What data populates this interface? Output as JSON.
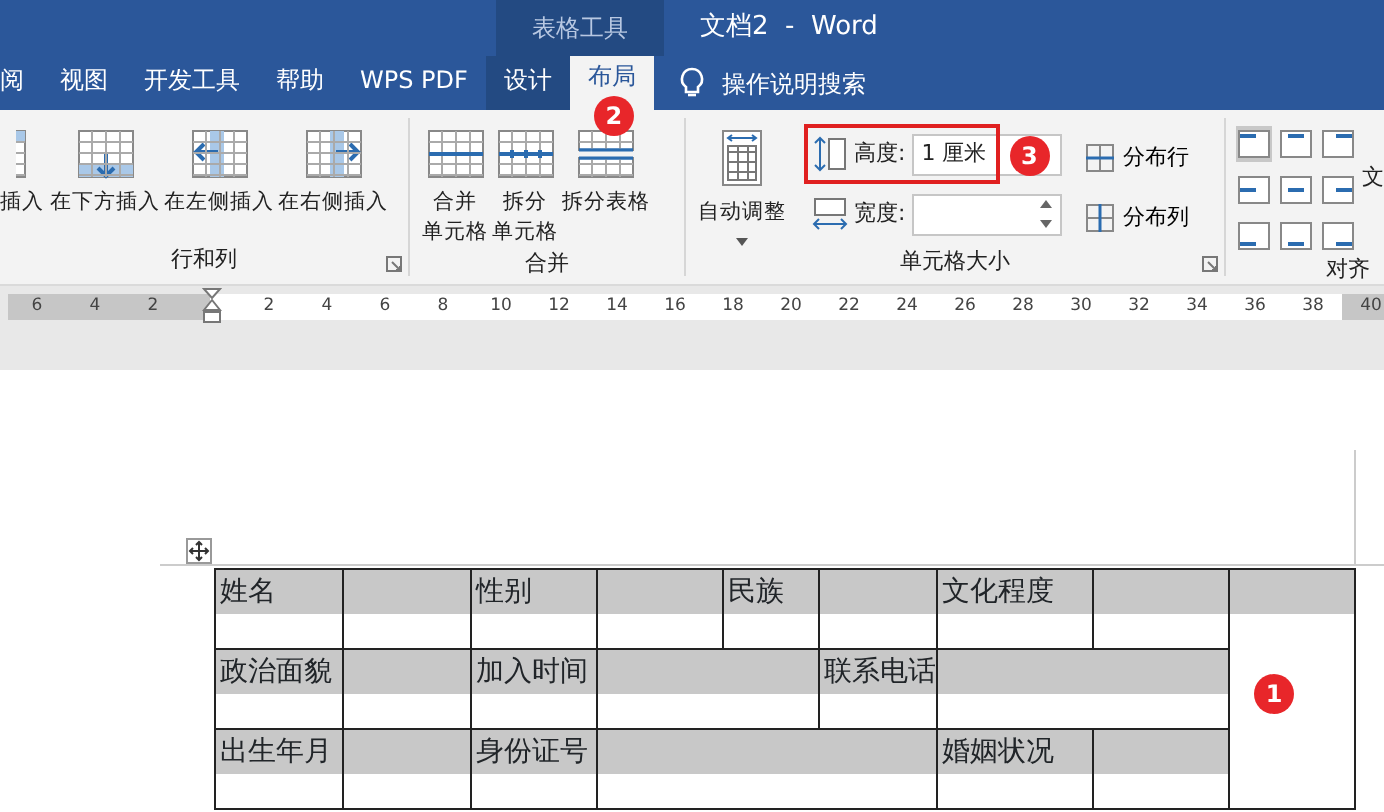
{
  "title_bar": {
    "context_label": "表格工具",
    "title": "文档2  -  Word"
  },
  "tabs": [
    {
      "label": "阅",
      "selected": false,
      "contextual": false
    },
    {
      "label": "视图",
      "selected": false,
      "contextual": false
    },
    {
      "label": "开发工具",
      "selected": false,
      "contextual": false
    },
    {
      "label": "帮助",
      "selected": false,
      "contextual": false
    },
    {
      "label": "WPS PDF",
      "selected": false,
      "contextual": false
    },
    {
      "label": "设计",
      "selected": false,
      "contextual": true
    },
    {
      "label": "布局",
      "selected": true,
      "contextual": true,
      "badge": "2"
    }
  ],
  "tell_me": {
    "label": "操作说明搜索"
  },
  "rows_group": {
    "label": "行和列",
    "items": [
      {
        "kind": "above",
        "label": "插入"
      },
      {
        "kind": "below",
        "label": "在下方插入"
      },
      {
        "kind": "left",
        "label": "在左侧插入"
      },
      {
        "kind": "right",
        "label": "在右侧插入"
      }
    ]
  },
  "merge_group": {
    "label": "合并",
    "items": [
      {
        "kind": "merge",
        "label_lines": [
          "合并",
          "单元格"
        ]
      },
      {
        "kind": "split",
        "label_lines": [
          "拆分",
          "单元格"
        ]
      },
      {
        "kind": "table",
        "label_lines": [
          "拆分表格"
        ]
      }
    ]
  },
  "size_group": {
    "label": "单元格大小",
    "autofit": {
      "label": "自动调整"
    },
    "fields": [
      {
        "kind": "height",
        "label": "高度:",
        "value": "1 厘米",
        "highlighted": true,
        "badge": "3"
      },
      {
        "kind": "width",
        "label": "宽度:",
        "highlighted": false
      }
    ],
    "distribute": [
      {
        "kind": "rows",
        "label": "分布行"
      },
      {
        "kind": "cols",
        "label": "分布列"
      }
    ]
  },
  "align_group": {
    "label": "对齐",
    "side_label": "文",
    "buttons": [
      {
        "selected": true
      },
      {
        "selected": false
      },
      {
        "selected": false
      },
      {
        "selected": false
      },
      {
        "selected": false
      },
      {
        "selected": false
      },
      {
        "selected": false
      },
      {
        "selected": false
      },
      {
        "selected": false
      }
    ]
  },
  "ruler": {
    "left_labels": [
      "6",
      "4",
      "2"
    ],
    "right_labels": [
      "2",
      "4",
      "6",
      "8",
      "10",
      "12",
      "14",
      "16",
      "18",
      "20",
      "22",
      "24",
      "26",
      "28",
      "30",
      "32",
      "34",
      "36",
      "38"
    ],
    "end_label": "40"
  },
  "table": {
    "badge": "1",
    "rows": [
      [
        {
          "text": "姓名"
        },
        {
          "text": ""
        },
        {
          "text": "性别"
        },
        {
          "text": ""
        },
        {
          "text": "民族"
        },
        {
          "text": ""
        },
        {
          "text": "文化程度"
        },
        {
          "text": ""
        },
        {
          "text": "",
          "rowspan": 3
        }
      ],
      [
        {
          "text": "政治面貌"
        },
        {
          "text": ""
        },
        {
          "text": "加入时间"
        },
        {
          "text": "",
          "colspan": 2
        },
        {
          "text": "联系电话"
        },
        {
          "text": "",
          "colspan": 2
        }
      ],
      [
        {
          "text": "出生年月"
        },
        {
          "text": ""
        },
        {
          "text": "身份证号"
        },
        {
          "text": "",
          "colspan": 3
        },
        {
          "text": "婚姻状况"
        },
        {
          "text": ""
        }
      ]
    ]
  }
}
